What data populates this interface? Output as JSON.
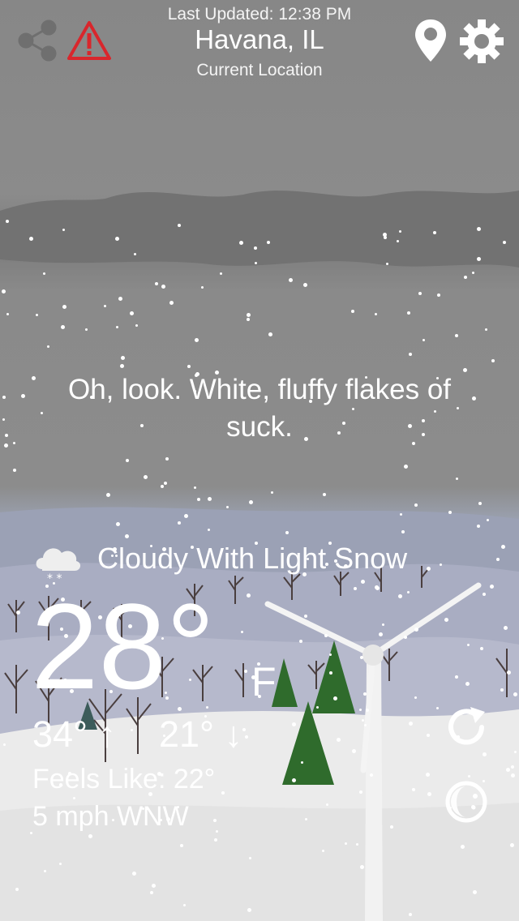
{
  "header": {
    "last_updated": "Last Updated: 12:38 PM",
    "city": "Havana, IL",
    "location_label": "Current Location"
  },
  "quote": "Oh, look. White, fluffy flakes of suck.",
  "conditions": {
    "icon": "cloud-snow-icon",
    "text": "Cloudy With Light Snow",
    "temperature": "28°",
    "unit": "F",
    "high": "34° ↑",
    "low": "21° ↓",
    "feels_like": "Feels Like: 22°",
    "wind": "5 mph WNW"
  },
  "icons": {
    "share": "share-icon",
    "alert": "alert-triangle-icon",
    "location": "location-pin-icon",
    "settings": "gear-icon",
    "refresh": "refresh-icon",
    "moon": "moon-icon"
  },
  "colors": {
    "sky": "#888888",
    "alert_red": "#d9262c",
    "tree_green": "#2f6b2c",
    "snow_ground": "#ebebeb"
  }
}
